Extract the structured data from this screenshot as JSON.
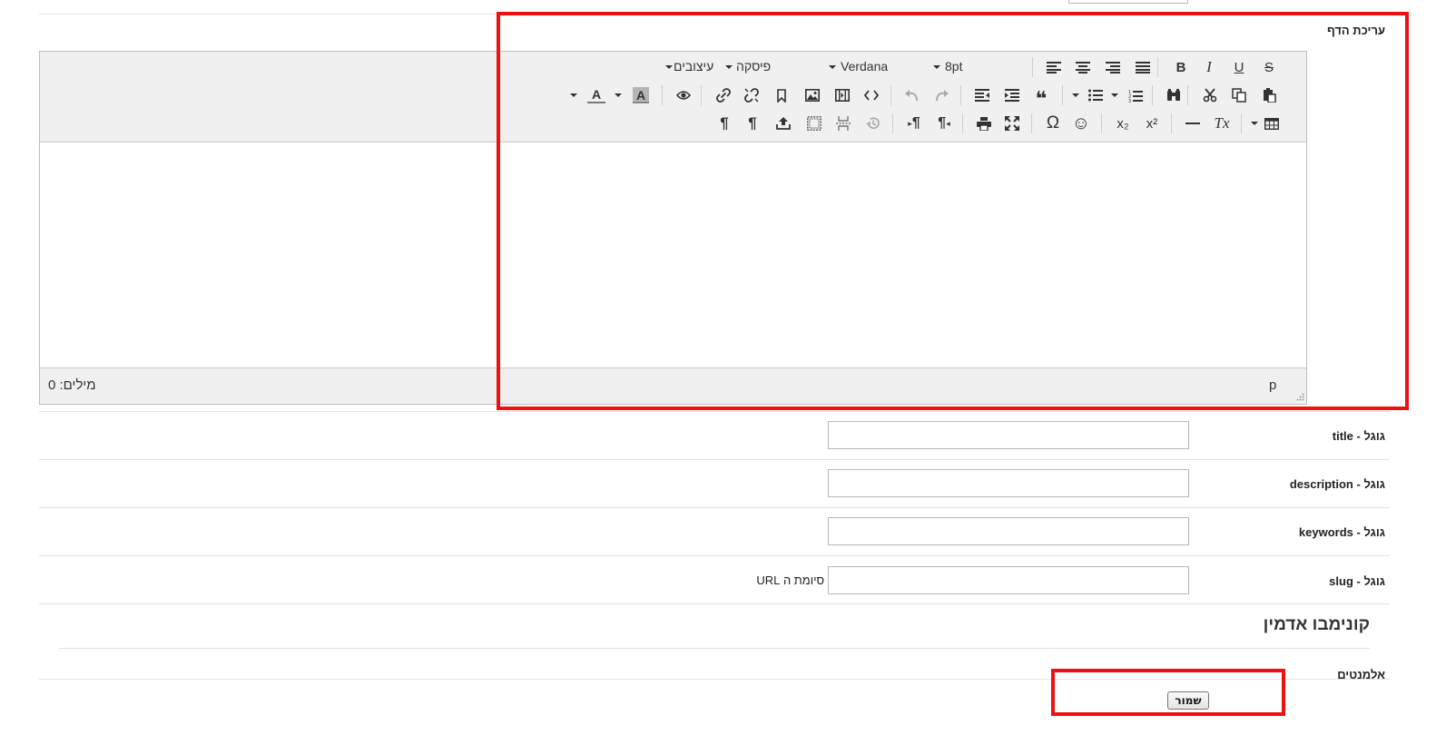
{
  "page_edit_label": "עריכת הדף",
  "editor": {
    "formats_label": "עיצובים",
    "paragraph_label": "פיסקה",
    "font_family": "Verdana",
    "font_size": "8pt",
    "path_element": "p",
    "word_count": "מילים: 0",
    "text_color_glyph": "A",
    "bg_color_glyph": "A",
    "omega_glyph": "Ω",
    "smiley_glyph": "☺",
    "pilcrow_glyph": "¶",
    "quote_glyph": "❝",
    "italic_glyph": "I",
    "bold_glyph": "B",
    "underline_glyph": "U",
    "strike_glyph": "S",
    "clear_glyph": "Tx",
    "sub_glyph": "x₂",
    "sup_glyph": "x²"
  },
  "fields": [
    {
      "label": "גוגל - title",
      "value": ""
    },
    {
      "label": "גוגל - description",
      "value": ""
    },
    {
      "label": "גוגל - keywords",
      "value": ""
    },
    {
      "label": "גוגל - slug",
      "value": "",
      "note": "סיומת ה URL"
    }
  ],
  "admin_section_title": "קונימבו אדמין",
  "elements_label": "אלמנטים",
  "save_button": "שמור",
  "colors": {
    "highlight_red": "#ee1111",
    "toolbar_bg": "#f0f0f0"
  }
}
